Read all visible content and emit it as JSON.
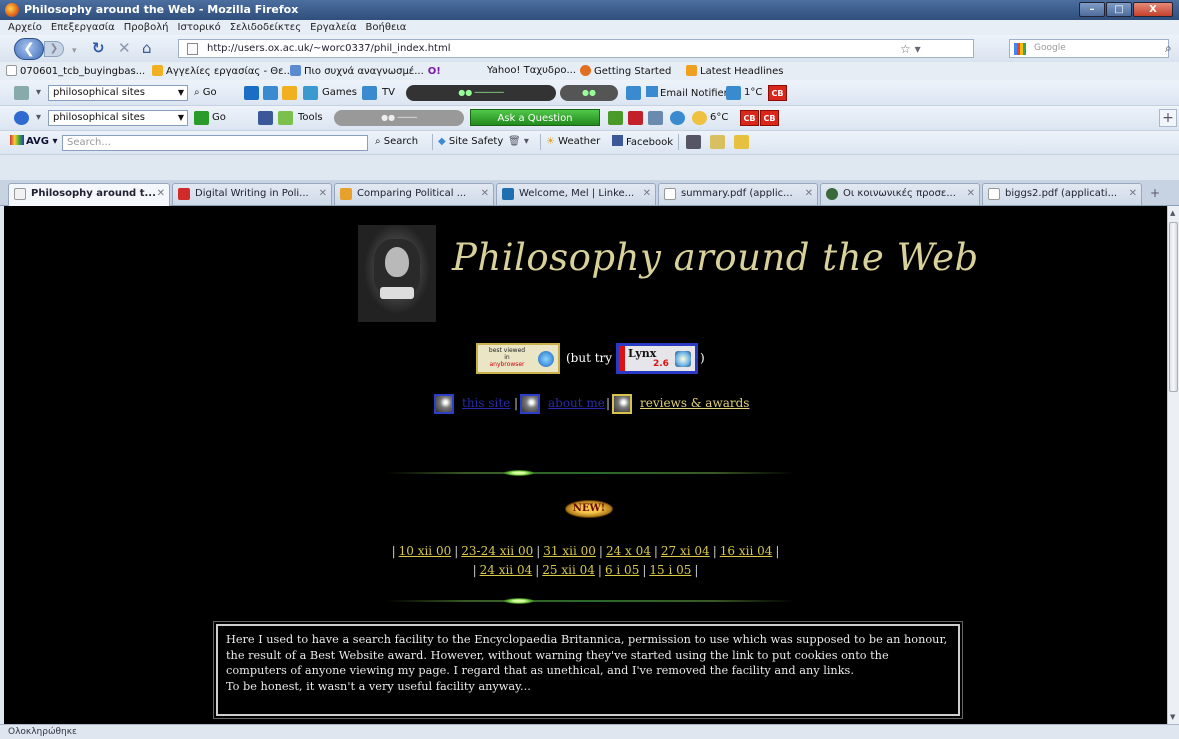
{
  "window": {
    "title": "Philosophy around the Web - Mozilla Firefox",
    "buttons": [
      "–",
      "□",
      "X"
    ]
  },
  "menu": [
    "Αρχείο",
    "Επεξεργασία",
    "Προβολή",
    "Ιστορικό",
    "Σελιδοδείκτες",
    "Εργαλεία",
    "Βοήθεια"
  ],
  "nav": {
    "url": "http://users.ox.ac.uk/~worc0337/phil_index.html",
    "search_placeholder": "Google"
  },
  "bookmarks": [
    "070601_tcb_buyingbas...",
    "Αγγελίες εργασίας - Θε...",
    "Πιο συχνά αναγνωσμέ...",
    "Yahoo! Ταχυδρο...",
    "Getting Started",
    "Latest Headlines"
  ],
  "toolbar1": {
    "combo": "philosophical sites",
    "go": "Go",
    "games": "Games",
    "tv": "TV",
    "email": "Email Notifier",
    "temp": "1°C",
    "cb": "CB"
  },
  "toolbar2": {
    "combo": "philosophical sites",
    "go": "Go",
    "tools": "Tools",
    "ask": "Ask a Question",
    "temp": "6°C",
    "cb": "CB",
    "plus": "+"
  },
  "toolbar3": {
    "avg": "AVG",
    "search_placeholder": "Search...",
    "search": "Search",
    "site_safety": "Site Safety",
    "weather": "Weather",
    "facebook": "Facebook"
  },
  "tabs": [
    {
      "label": "Philosophy around t...",
      "active": true,
      "color": "#f2f2f2"
    },
    {
      "label": "Digital Writing in Poli...",
      "active": false,
      "color": "#d12a2a"
    },
    {
      "label": "Comparing Political ...",
      "active": false,
      "color": "#e8a12a"
    },
    {
      "label": "Welcome, Mel | Linke...",
      "active": false,
      "color": "#1f6fb0"
    },
    {
      "label": "summary.pdf (applic...",
      "active": false,
      "color": "#ffffff"
    },
    {
      "label": "Οι κοινωνικές προσε...",
      "active": false,
      "color": "#3a6a3a"
    },
    {
      "label": "biggs2.pdf (applicati...",
      "active": false,
      "color": "#ffffff"
    }
  ],
  "page": {
    "title": "Philosophy around the Web",
    "badge_anybrowser": {
      "line1": "best viewed",
      "line2": "in",
      "line3": "anybrowser"
    },
    "but_try": "(but try",
    "lynx": {
      "name": "Lynx",
      "version": "2.6"
    },
    "close_paren": ")",
    "links": {
      "site": "this site",
      "about": "about me",
      "reviews": "reviews & awards"
    },
    "new_label": "NEW!",
    "dates_row1": [
      "10 xii 00",
      "23-24 xii 00",
      "31 xii 00",
      "24 x 04",
      "27 xi 04",
      "16 xii 04"
    ],
    "dates_row2": [
      "24 xii 04",
      "25 xii 04",
      "6 i 05",
      "15 i 05"
    ],
    "notice": "Here I used to have a search facility to the Encyclopaedia Britannica, permission to use which was supposed to be an honour, the result of a Best Website award. However, without warning they've started using the link to put cookies onto the computers of anyone viewing my page. I regard that as unethical, and I've removed the facility and any links.",
    "notice2": "To be honest, it wasn't a very useful facility anyway..."
  },
  "status": "Ολοκληρώθηκε"
}
